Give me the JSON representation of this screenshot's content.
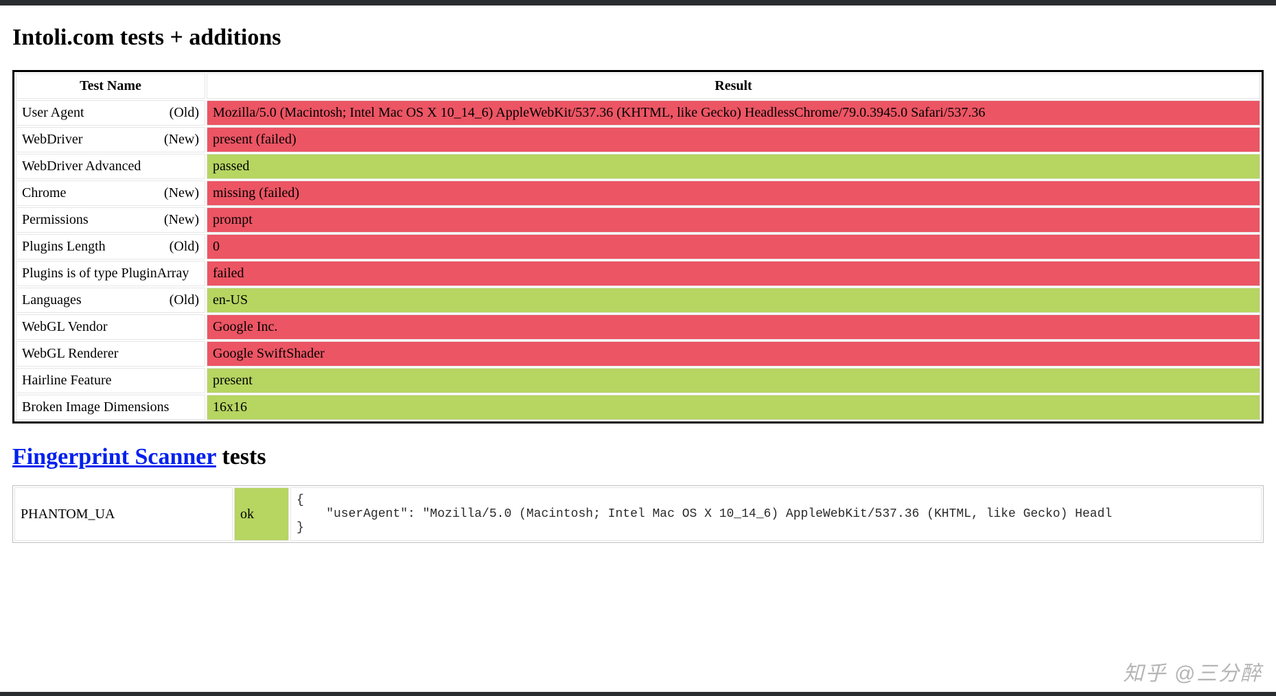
{
  "heading1": "Intoli.com tests + additions",
  "table1": {
    "headers": {
      "name": "Test Name",
      "result": "Result"
    },
    "rows": [
      {
        "name": "User Agent",
        "tag": "(Old)",
        "result": "Mozilla/5.0 (Macintosh; Intel Mac OS X 10_14_6) AppleWebKit/537.36 (KHTML, like Gecko) HeadlessChrome/79.0.3945.0 Safari/537.36",
        "status": "fail"
      },
      {
        "name": "WebDriver",
        "tag": "(New)",
        "result": "present (failed)",
        "status": "fail"
      },
      {
        "name": "WebDriver Advanced",
        "tag": "",
        "result": "passed",
        "status": "pass"
      },
      {
        "name": "Chrome",
        "tag": "(New)",
        "result": "missing (failed)",
        "status": "fail"
      },
      {
        "name": "Permissions",
        "tag": "(New)",
        "result": "prompt",
        "status": "fail"
      },
      {
        "name": "Plugins Length",
        "tag": "(Old)",
        "result": "0",
        "status": "fail"
      },
      {
        "name": "Plugins is of type PluginArray",
        "tag": "",
        "result": "failed",
        "status": "fail"
      },
      {
        "name": "Languages",
        "tag": "(Old)",
        "result": "en-US",
        "status": "pass"
      },
      {
        "name": "WebGL Vendor",
        "tag": "",
        "result": "Google Inc.",
        "status": "fail"
      },
      {
        "name": "WebGL Renderer",
        "tag": "",
        "result": "Google SwiftShader",
        "status": "fail"
      },
      {
        "name": "Hairline Feature",
        "tag": "",
        "result": "present",
        "status": "pass"
      },
      {
        "name": "Broken Image Dimensions",
        "tag": "",
        "result": "16x16",
        "status": "pass"
      }
    ]
  },
  "heading2_link": "Fingerprint Scanner",
  "heading2_rest": " tests",
  "table2": {
    "rows": [
      {
        "name": "PHANTOM_UA",
        "status_label": "ok",
        "status": "pass",
        "data": "{\n    \"userAgent\": \"Mozilla/5.0 (Macintosh; Intel Mac OS X 10_14_6) AppleWebKit/537.36 (KHTML, like Gecko) Headl\n}"
      }
    ]
  },
  "watermark": "知乎 @三分醉"
}
